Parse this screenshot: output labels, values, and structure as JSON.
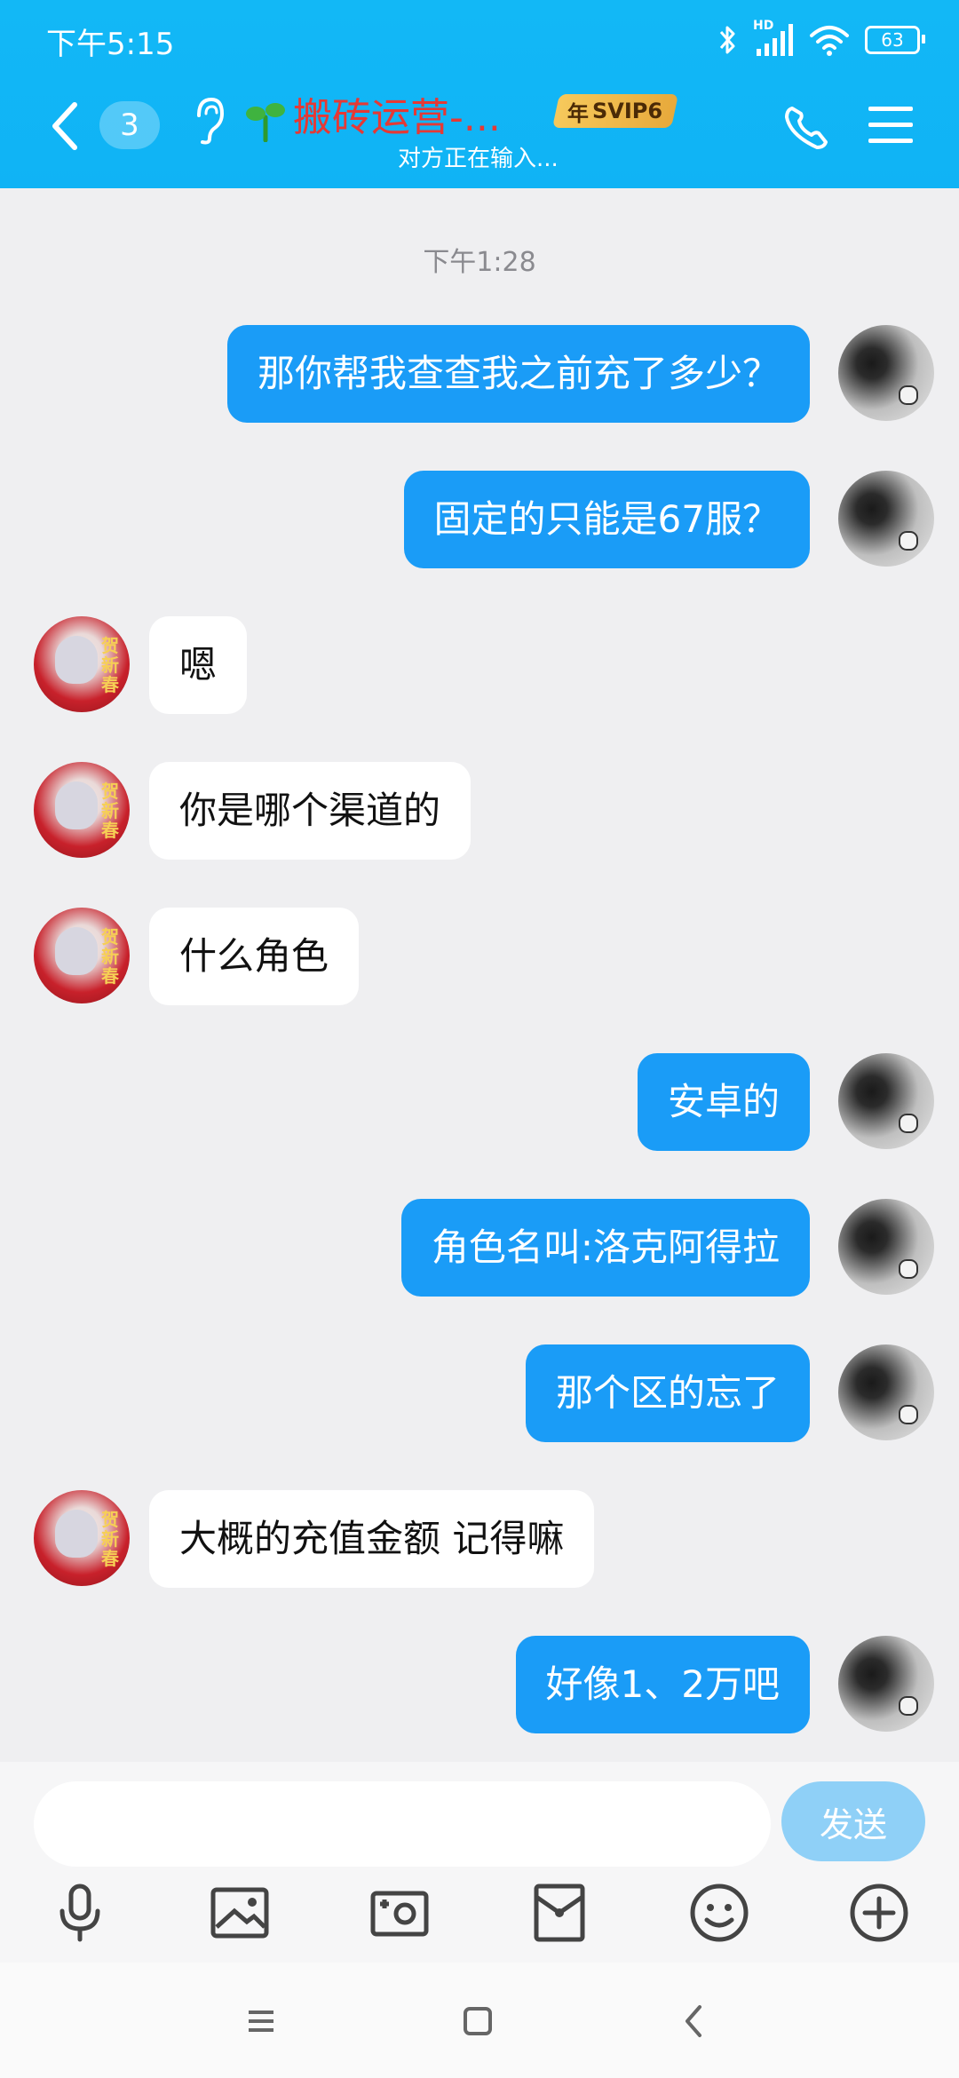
{
  "status_bar": {
    "time": "下午5:15",
    "hd_label": "HD",
    "battery": "63",
    "icons": [
      "bluetooth-icon",
      "signal-icon",
      "wifi-icon",
      "battery-icon"
    ]
  },
  "header": {
    "unread_count": "3",
    "title": "搬砖运营-...",
    "svip_badge_year": "年",
    "svip_badge": "SVIP6",
    "typing_status": "对方正在输入...",
    "title_color": "#e53935",
    "header_color": "#12b8f6"
  },
  "chat": {
    "timestamp": "下午1:28",
    "messages": [
      {
        "sender": "me",
        "text": "那你帮我查查我之前充了多少？"
      },
      {
        "sender": "me",
        "text": "固定的只能是67服？"
      },
      {
        "sender": "them",
        "text": "嗯"
      },
      {
        "sender": "them",
        "text": "你是哪个渠道的"
      },
      {
        "sender": "them",
        "text": "什么角色"
      },
      {
        "sender": "me",
        "text": "安卓的"
      },
      {
        "sender": "me",
        "text": "角色名叫:洛克阿得拉"
      },
      {
        "sender": "me",
        "text": "那个区的忘了"
      },
      {
        "sender": "them",
        "text": "大概的充值金额 记得嘛"
      },
      {
        "sender": "me",
        "text": "好像1、2万吧"
      }
    ],
    "outgoing_color": "#1a9cf7",
    "incoming_color": "#ffffff"
  },
  "input_bar": {
    "placeholder": "",
    "send_label": "发送",
    "tools": [
      "microphone-icon",
      "image-icon",
      "camera-icon",
      "red-packet-icon",
      "emoji-icon",
      "plus-icon"
    ]
  },
  "nav_bar": {
    "buttons": [
      "menu-icon",
      "home-icon",
      "back-icon"
    ]
  }
}
